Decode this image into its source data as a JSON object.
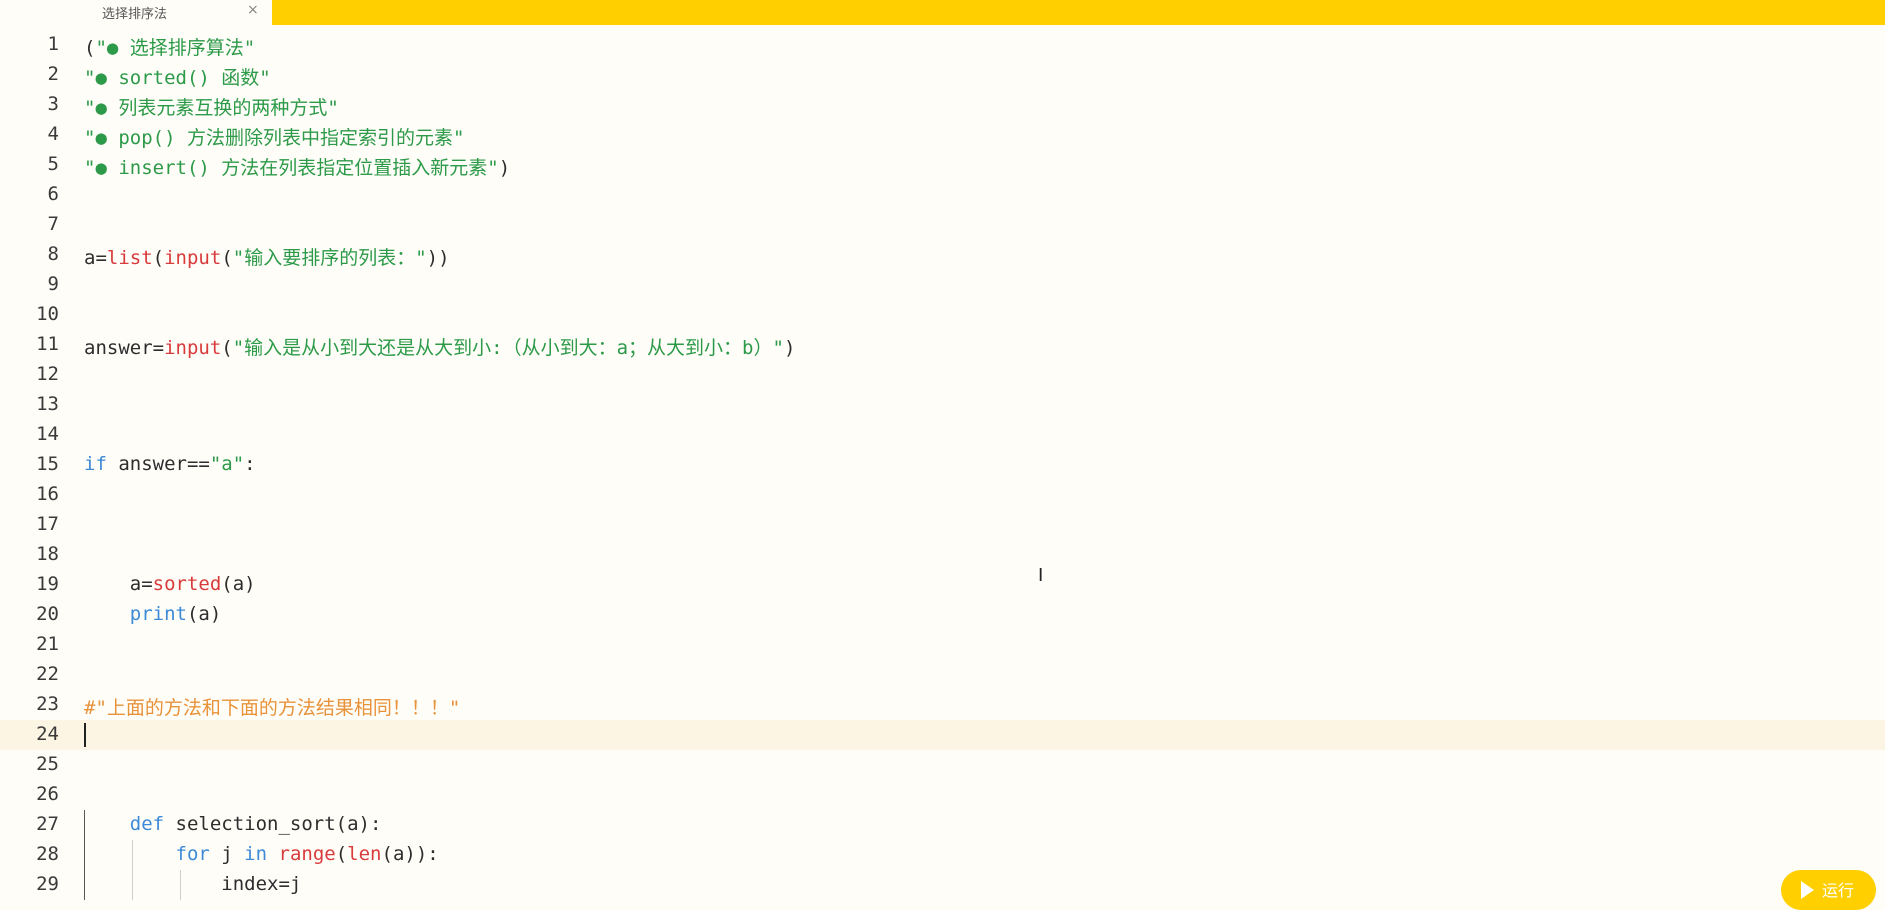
{
  "tab": {
    "title": "选择排序法",
    "close_glyph": "×"
  },
  "editor": {
    "current_line": 24,
    "lines": [
      {
        "n": "1",
        "tokens": [
          {
            "t": "(",
            "c": "t"
          },
          {
            "t": "\"● 选择排序算法\"",
            "c": "s"
          }
        ]
      },
      {
        "n": "2",
        "tokens": [
          {
            "t": "\"● sorted() 函数\"",
            "c": "s"
          }
        ]
      },
      {
        "n": "3",
        "tokens": [
          {
            "t": "\"● 列表元素互换的两种方式\"",
            "c": "s"
          }
        ]
      },
      {
        "n": "4",
        "tokens": [
          {
            "t": "\"● pop() 方法删除列表中指定索引的元素\"",
            "c": "s"
          }
        ]
      },
      {
        "n": "5",
        "tokens": [
          {
            "t": "\"● insert() 方法在列表指定位置插入新元素\"",
            "c": "s"
          },
          {
            "t": ")",
            "c": "t"
          }
        ]
      },
      {
        "n": "6",
        "tokens": []
      },
      {
        "n": "7",
        "tokens": []
      },
      {
        "n": "8",
        "tokens": [
          {
            "t": "a=",
            "c": "t"
          },
          {
            "t": "list",
            "c": "f"
          },
          {
            "t": "(",
            "c": "t"
          },
          {
            "t": "input",
            "c": "f"
          },
          {
            "t": "(",
            "c": "t"
          },
          {
            "t": "\"输入要排序的列表：\"",
            "c": "s"
          },
          {
            "t": "))",
            "c": "t"
          }
        ]
      },
      {
        "n": "9",
        "tokens": []
      },
      {
        "n": "10",
        "tokens": []
      },
      {
        "n": "11",
        "tokens": [
          {
            "t": "answer=",
            "c": "t"
          },
          {
            "t": "input",
            "c": "f"
          },
          {
            "t": "(",
            "c": "t"
          },
          {
            "t": "\"输入是从小到大还是从大到小:（从小到大：a；从大到小：b）\"",
            "c": "s"
          },
          {
            "t": ")",
            "c": "t"
          }
        ]
      },
      {
        "n": "12",
        "tokens": []
      },
      {
        "n": "13",
        "tokens": []
      },
      {
        "n": "14",
        "tokens": []
      },
      {
        "n": "15",
        "tokens": [
          {
            "t": "if",
            "c": "k"
          },
          {
            "t": " answer==",
            "c": "t"
          },
          {
            "t": "\"a\"",
            "c": "s"
          },
          {
            "t": ":",
            "c": "t"
          }
        ]
      },
      {
        "n": "16",
        "tokens": []
      },
      {
        "n": "17",
        "tokens": []
      },
      {
        "n": "18",
        "tokens": []
      },
      {
        "n": "19",
        "tokens": [
          {
            "t": "    a=",
            "c": "t"
          },
          {
            "t": "sorted",
            "c": "f"
          },
          {
            "t": "(a)",
            "c": "t"
          }
        ]
      },
      {
        "n": "20",
        "tokens": [
          {
            "t": "    ",
            "c": "t"
          },
          {
            "t": "print",
            "c": "k"
          },
          {
            "t": "(a)",
            "c": "t"
          }
        ]
      },
      {
        "n": "21",
        "tokens": []
      },
      {
        "n": "22",
        "tokens": []
      },
      {
        "n": "23",
        "tokens": [
          {
            "t": "#\"上面的方法和下面的方法结果相同！！！\"",
            "c": "c"
          }
        ]
      },
      {
        "n": "24",
        "tokens": []
      },
      {
        "n": "25",
        "tokens": []
      },
      {
        "n": "26",
        "tokens": []
      },
      {
        "n": "27",
        "tokens": [
          {
            "t": "    ",
            "c": "t"
          },
          {
            "t": "def",
            "c": "k"
          },
          {
            "t": " selection_sort(a):",
            "c": "t"
          }
        ]
      },
      {
        "n": "28",
        "tokens": [
          {
            "t": "        ",
            "c": "t"
          },
          {
            "t": "for",
            "c": "k"
          },
          {
            "t": " j ",
            "c": "t"
          },
          {
            "t": "in",
            "c": "k"
          },
          {
            "t": " ",
            "c": "t"
          },
          {
            "t": "range",
            "c": "f"
          },
          {
            "t": "(",
            "c": "t"
          },
          {
            "t": "len",
            "c": "f"
          },
          {
            "t": "(a)):",
            "c": "t"
          }
        ]
      },
      {
        "n": "29",
        "tokens": [
          {
            "t": "            index=j",
            "c": "t"
          }
        ]
      }
    ]
  },
  "run_button": {
    "label": "运行"
  }
}
